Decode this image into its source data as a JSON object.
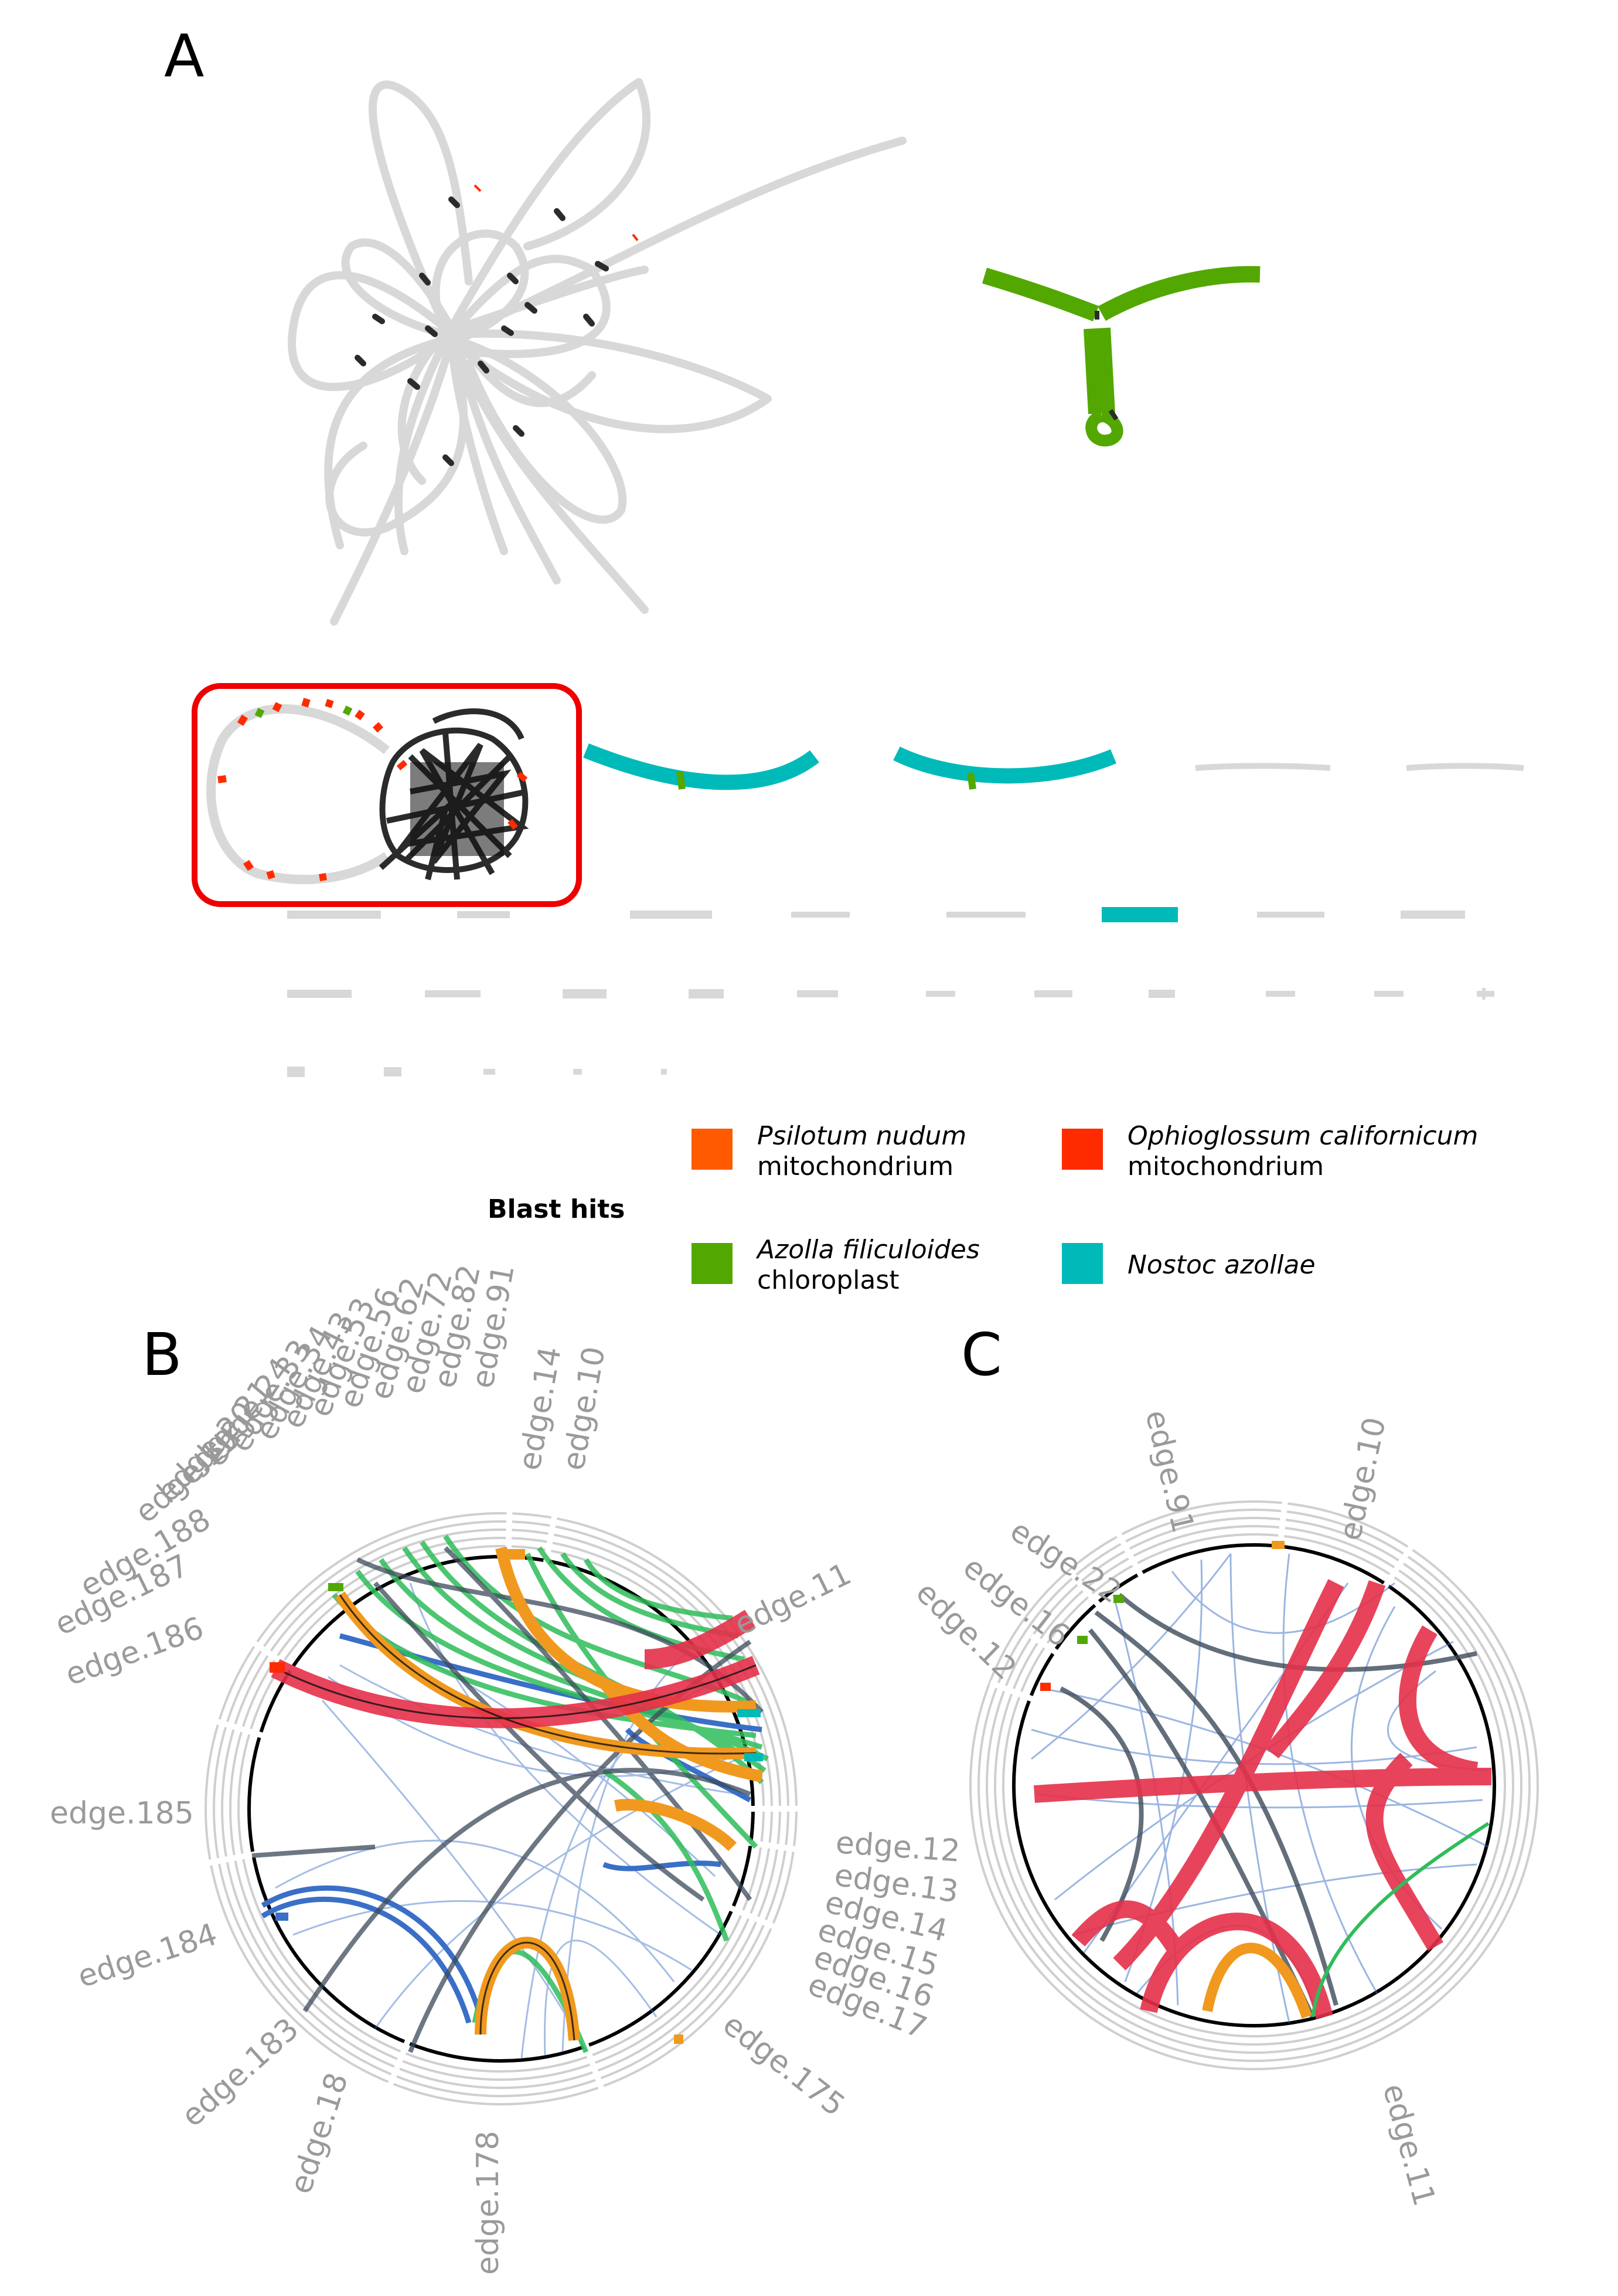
{
  "panels": {
    "a": "A",
    "b": "B",
    "c": "C"
  },
  "colors": {
    "graph_gray": "#d8d8d8",
    "graph_dark": "#2b2b2b",
    "highlight_box": "#ee0000",
    "green": "#52a800",
    "teal": "#00bab9",
    "orange": "#ff5a00",
    "red": "#ff2b00"
  },
  "legend": {
    "title": "Blast hits",
    "items": [
      {
        "name": "Psilotum nudum",
        "sub": "mitochondrium",
        "color": "#ff5a00"
      },
      {
        "name": "Ophioglossum californicum",
        "sub": "mitochondrium",
        "color": "#ff2b00"
      },
      {
        "name": "Azolla filiculoides",
        "sub": "chloroplast",
        "color": "#52a800"
      },
      {
        "name": "Nostoc azollae",
        "sub": "",
        "color": "#00bab9"
      }
    ]
  },
  "panel_b": {
    "labels": [
      "edge.10",
      "edge.14",
      "edge.91",
      "edge.82",
      "edge.72",
      "edge.62",
      "edge.56",
      "edge.53",
      "edge.43",
      "edge.34",
      "edge.33",
      "edge.24",
      "edge.21",
      "edge.20",
      "edge.19",
      "edge.188",
      "edge.187",
      "edge.186",
      "edge.185",
      "edge.184",
      "edge.183",
      "edge.18",
      "edge.178",
      "edge.175",
      "edge.17",
      "edge.16",
      "edge.15",
      "edge.14",
      "edge.13",
      "edge.12",
      "edge.11"
    ]
  },
  "panel_c": {
    "labels": [
      "edge.91",
      "edge.10",
      "edge.22",
      "edge.16",
      "edge.12",
      "edge.11"
    ]
  }
}
